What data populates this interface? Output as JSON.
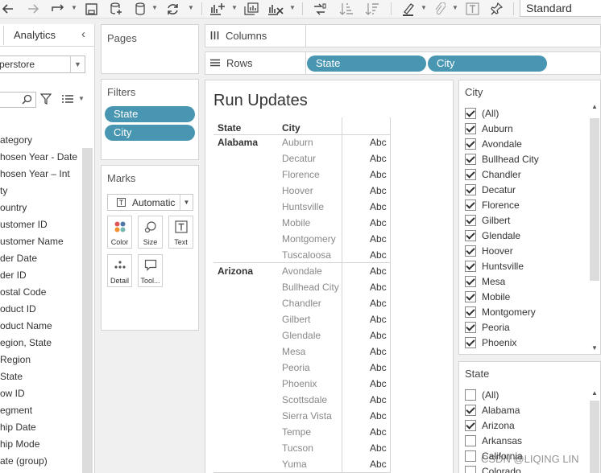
{
  "toolbar": {
    "view_dropdown": "Standard",
    "icons": [
      "back-arrow",
      "forward-arrow",
      "redo-arrow",
      "save",
      "new-datasource",
      "datasource",
      "refresh",
      "new-worksheet",
      "duplicate-sheet",
      "clear-sheet",
      "swap",
      "sort-ascending",
      "sort-descending",
      "highlight",
      "pin",
      "text-label",
      "presentation"
    ]
  },
  "data_pane": {
    "tab": "Analytics",
    "datasource": "perstore",
    "fields": [
      "ategory",
      "hosen Year - Date",
      "hosen Year – Int",
      "ty",
      "ountry",
      "ustomer ID",
      "ustomer Name",
      "der Date",
      "der ID",
      "ostal Code",
      "oduct ID",
      "oduct Name",
      "egion, State",
      " Region",
      " State",
      "ow ID",
      "egment",
      "hip Date",
      "hip Mode",
      "ate (group)"
    ]
  },
  "pages": {
    "title": "Pages"
  },
  "filters": {
    "title": "Filters",
    "pills": [
      "State",
      "City"
    ]
  },
  "marks": {
    "title": "Marks",
    "type": "Automatic",
    "buttons": [
      "Color",
      "Size",
      "Text",
      "Detail",
      "Tool..."
    ]
  },
  "shelves": {
    "columns_label": "Columns",
    "rows_label": "Rows",
    "rows_pills": [
      "State",
      "City"
    ]
  },
  "view": {
    "title": "Run Updates",
    "headers": [
      "State",
      "City"
    ],
    "groups": [
      {
        "state": "Alabama",
        "cities": [
          "Auburn",
          "Decatur",
          "Florence",
          "Hoover",
          "Huntsville",
          "Mobile",
          "Montgomery",
          "Tuscaloosa"
        ]
      },
      {
        "state": "Arizona",
        "cities": [
          "Avondale",
          "Bullhead City",
          "Chandler",
          "Gilbert",
          "Glendale",
          "Mesa",
          "Peoria",
          "Phoenix",
          "Scottsdale",
          "Sierra Vista",
          "Tempe",
          "Tucson",
          "Yuma"
        ]
      }
    ],
    "cell_text": "Abc"
  },
  "city_filter": {
    "title": "City",
    "items": [
      {
        "label": "(All)",
        "checked": true
      },
      {
        "label": "Auburn",
        "checked": true
      },
      {
        "label": "Avondale",
        "checked": true
      },
      {
        "label": "Bullhead City",
        "checked": true
      },
      {
        "label": "Chandler",
        "checked": true
      },
      {
        "label": "Decatur",
        "checked": true
      },
      {
        "label": "Florence",
        "checked": true
      },
      {
        "label": "Gilbert",
        "checked": true
      },
      {
        "label": "Glendale",
        "checked": true
      },
      {
        "label": "Hoover",
        "checked": true
      },
      {
        "label": "Huntsville",
        "checked": true
      },
      {
        "label": "Mesa",
        "checked": true
      },
      {
        "label": "Mobile",
        "checked": true
      },
      {
        "label": "Montgomery",
        "checked": true
      },
      {
        "label": "Peoria",
        "checked": true
      },
      {
        "label": "Phoenix",
        "checked": true
      }
    ]
  },
  "state_filter": {
    "title": "State",
    "items": [
      {
        "label": "(All)",
        "checked": false
      },
      {
        "label": "Alabama",
        "checked": true
      },
      {
        "label": "Arizona",
        "checked": true
      },
      {
        "label": "Arkansas",
        "checked": false
      },
      {
        "label": "California",
        "checked": false
      },
      {
        "label": "Colorado",
        "checked": false
      }
    ]
  },
  "watermark": "CSDN @LIQING LIN",
  "colors": {
    "pill": "#4996b2",
    "panel_border": "#d4d4d4",
    "background": "#f0f0f0"
  }
}
